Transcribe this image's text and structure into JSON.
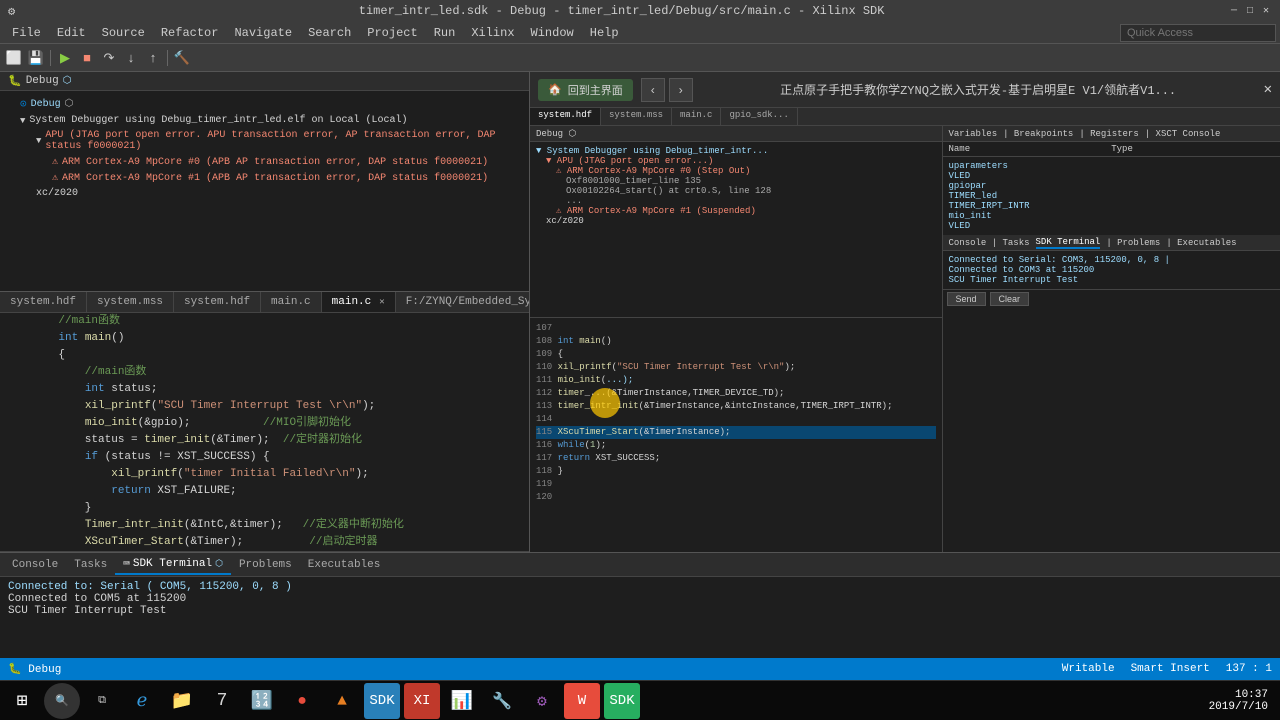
{
  "titleBar": {
    "title": "timer_intr_led.sdk - Debug - timer_intr_led/Debug/src/main.c - Xilinx SDK",
    "controls": [
      "–",
      "□",
      "✕"
    ]
  },
  "menuBar": {
    "items": [
      "File",
      "Edit",
      "Source",
      "Refactor",
      "Navigate",
      "Search",
      "Project",
      "Run",
      "Xilinx",
      "Window",
      "Help"
    ]
  },
  "toolbar": {
    "quickAccess": "Quick Access"
  },
  "debugPanel": {
    "title": "Debug",
    "mode": "Debug",
    "items": [
      {
        "label": "System Debugger using Debug_timer_intr_led.elf on Local (Local)",
        "indent": 1
      },
      {
        "label": "APU (JTAG port open error. APU transaction error, AP transaction error, DAP status f0000021)",
        "indent": 2
      },
      {
        "label": "ARM Cortex-A9 MpCore #0 (APB AP transaction error, DAP status f0000021)",
        "indent": 3
      },
      {
        "label": "ARM Cortex-A9 MpCore #1 (APB AP transaction error, DAP status f0000021)",
        "indent": 3
      },
      {
        "label": "xc/z020",
        "indent": 2
      }
    ]
  },
  "editorTabs": [
    {
      "label": "system.hdf",
      "active": false
    },
    {
      "label": "system.mss",
      "active": false
    },
    {
      "label": "system.hdf",
      "active": false
    },
    {
      "label": "main.c",
      "active": false
    },
    {
      "label": "main.c",
      "active": true
    },
    {
      "label": "F:/ZYNQ/Embedded_Syst...",
      "active": false
    }
  ],
  "codeLines": [
    {
      "num": "",
      "code": ""
    },
    {
      "num": "",
      "code": "    //main函数"
    },
    {
      "num": "",
      "code": "    int main()"
    },
    {
      "num": "",
      "code": "    {"
    },
    {
      "num": "",
      "code": ""
    },
    {
      "num": "",
      "code": "        //main函数"
    },
    {
      "num": "",
      "code": "        int status;"
    },
    {
      "num": "",
      "code": "        xil_printf(\"SCU Timer Interrupt Test \\r\\n\");"
    },
    {
      "num": "",
      "code": ""
    },
    {
      "num": "",
      "code": "        mio_init(&gpio);           //MIO引脚初始化"
    },
    {
      "num": "",
      "code": "        status = timer_init(&Timer);  //定时器初始化"
    },
    {
      "num": "",
      "code": "        if (status != XST_SUCCESS) {"
    },
    {
      "num": "",
      "code": "            xil_printf(\"timer Initial Failed\\r\\n\");"
    },
    {
      "num": "",
      "code": "            return XST_FAILURE;"
    },
    {
      "num": "",
      "code": "        }"
    },
    {
      "num": "",
      "code": ""
    },
    {
      "num": "",
      "code": "        Timer_intr_init(&IntC,&timer);   //定义器中断初始化"
    },
    {
      "num": "",
      "code": "        XScuTimer_Start(&Timer);          //启动定时器"
    }
  ],
  "consoleTabs": [
    {
      "label": "Console",
      "active": false
    },
    {
      "label": "Tasks",
      "active": false
    },
    {
      "label": "SDK Terminal",
      "active": true
    },
    {
      "label": "Problems",
      "active": false
    },
    {
      "label": "Executables",
      "active": false
    }
  ],
  "terminalContent": {
    "statusLine": "Connected to: Serial ( COM5, 115200, 0, 8 )",
    "line1": "Connected to COM5 at 115200",
    "line2": "SCU Timer Interrupt Test"
  },
  "serialInput": {
    "placeholder": "",
    "sendLabel": "Send",
    "clearLabel": "Clear"
  },
  "overlayBrowser": {
    "title": "正点原子手把手教你学ZYNQ之嵌入式开发-基于启明星E V1/领航者V1...",
    "homeLabel": "回到主界面"
  },
  "statusBar": {
    "writable": "Writable",
    "smartInsert": "Smart Insert",
    "position": "137 : 1"
  },
  "taskbarTime": {
    "time": "10:37",
    "date": "2019/7/10"
  }
}
